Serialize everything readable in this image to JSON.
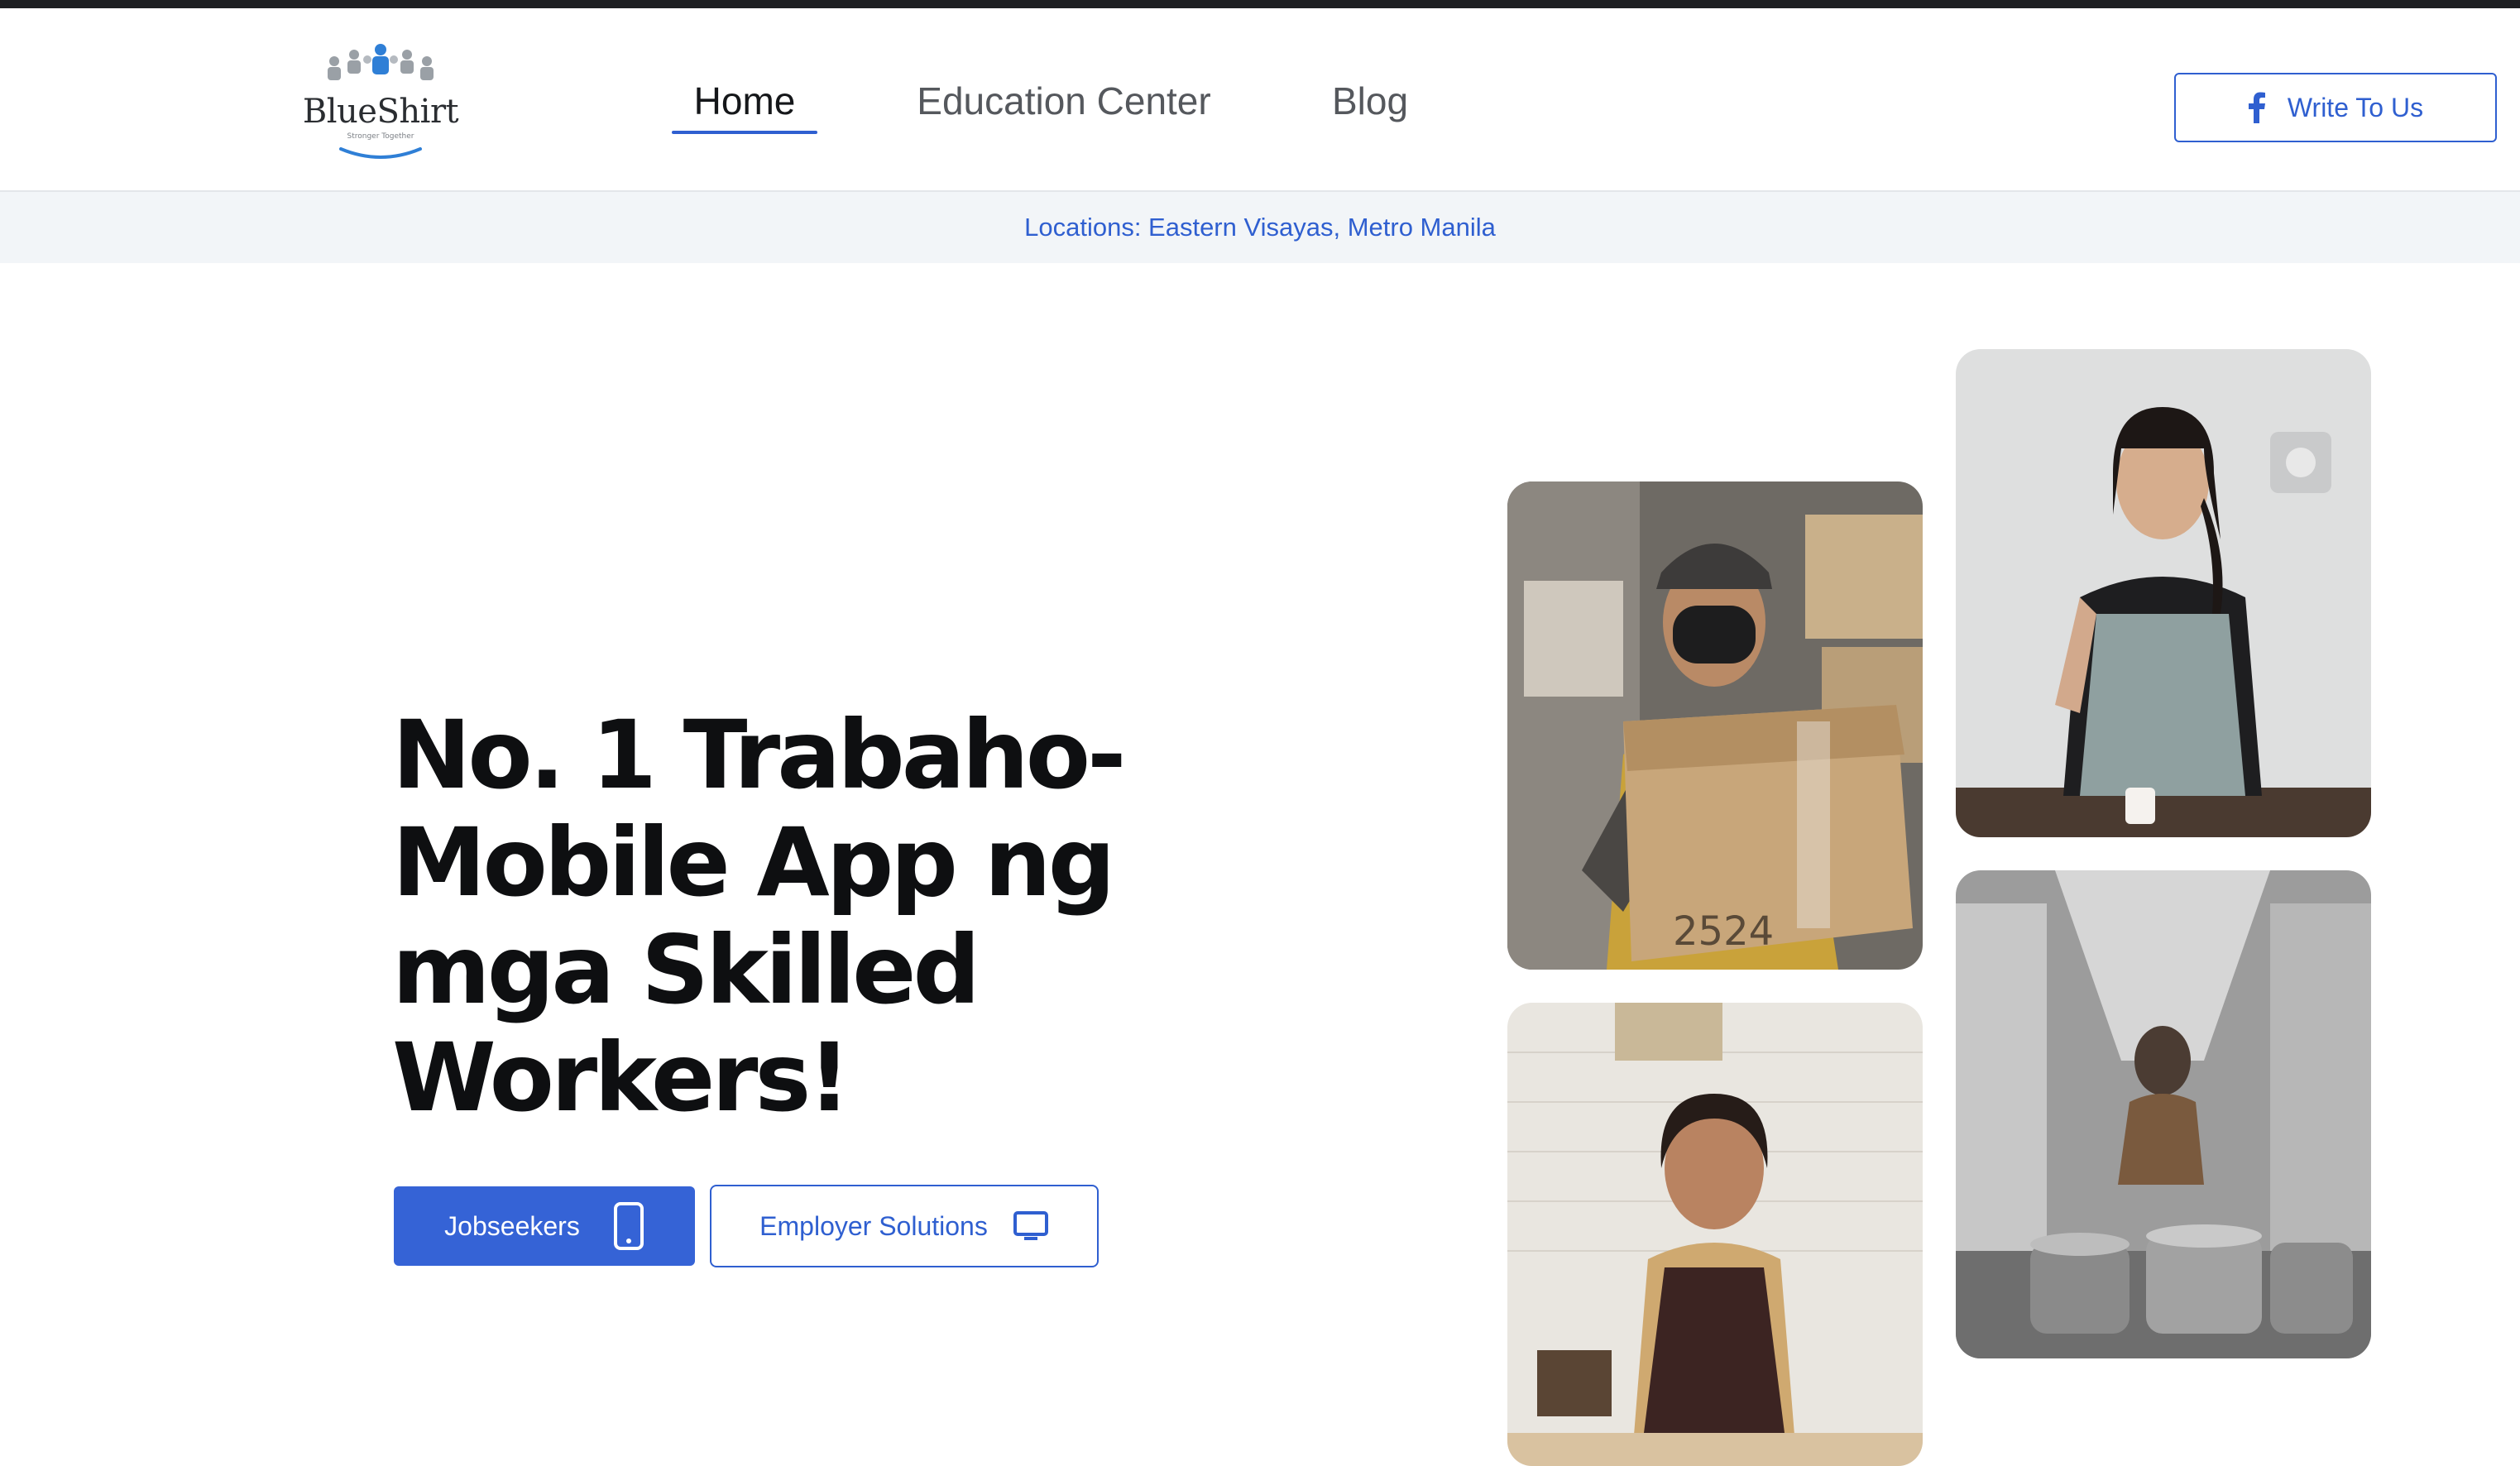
{
  "brand": {
    "name": "BlueShirt",
    "tagline": "Stronger Together",
    "colors": {
      "accent": "#2f5fd0",
      "button_fill": "#3563d6",
      "text_dark": "#0e0f11"
    }
  },
  "nav": {
    "items": [
      {
        "label": "Home",
        "active": true
      },
      {
        "label": "Education Center",
        "active": false
      },
      {
        "label": "Blog",
        "active": false
      }
    ]
  },
  "header": {
    "write_button": {
      "label": "Write To Us",
      "icon": "facebook-icon"
    }
  },
  "location_bar": {
    "text": "Locations: Eastern Visayas, Metro Manila"
  },
  "hero": {
    "headline": "No. 1 Trabaho-Mobile App ng mga Skilled Workers!",
    "buttons": [
      {
        "label": "Jobseekers",
        "icon": "mobile-phone-icon"
      },
      {
        "label": "Employer Solutions",
        "icon": "desktop-monitor-icon"
      }
    ]
  }
}
